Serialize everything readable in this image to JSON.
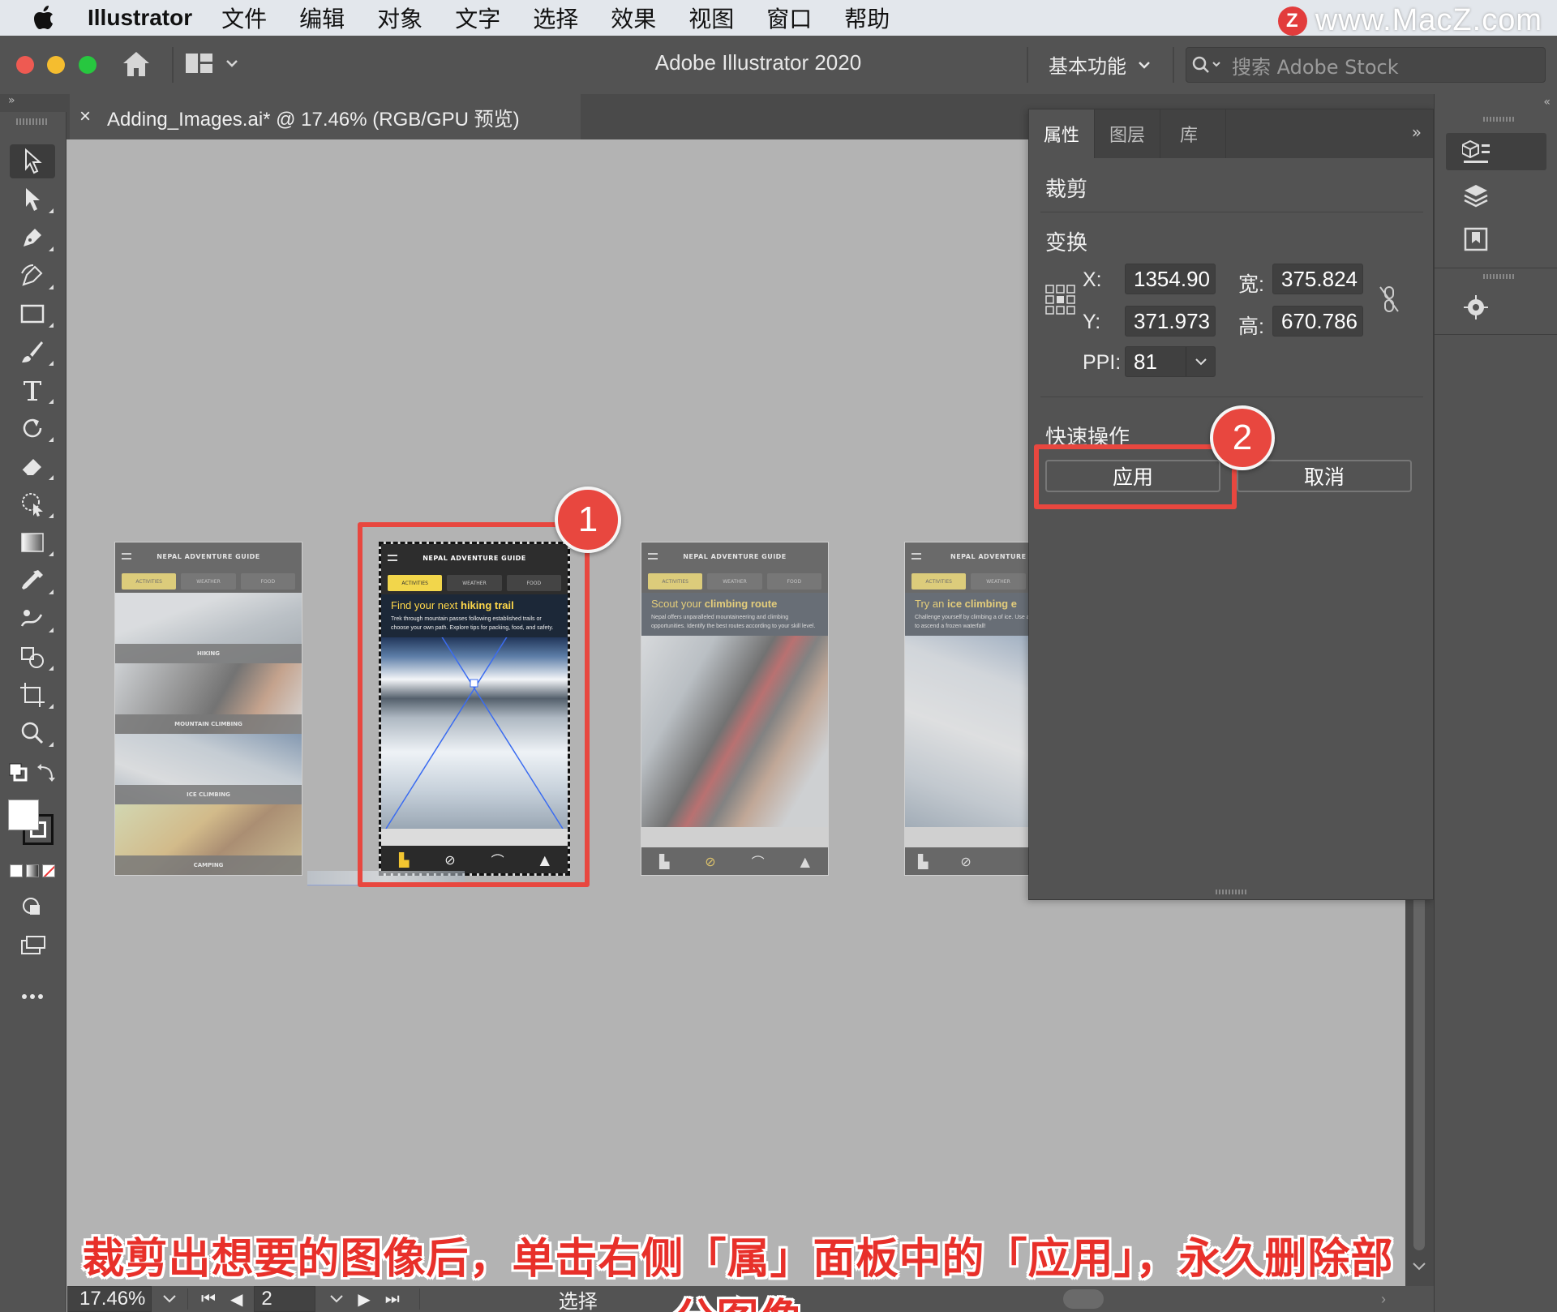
{
  "menubar": {
    "app_name": "Illustrator",
    "items": [
      "文件",
      "编辑",
      "对象",
      "文字",
      "选择",
      "效果",
      "视图",
      "窗口",
      "帮助"
    ],
    "watermark_logo": "Z",
    "watermark": "www.MacZ.com"
  },
  "titlebar": {
    "title": "Adobe Illustrator 2020",
    "workspace": "基本功能",
    "search_placeholder": "搜索 Adobe Stock"
  },
  "document": {
    "tab_close": "×",
    "tab_title": "Adding_Images.ai* @ 17.46% (RGB/GPU 预览)"
  },
  "artboards": [
    {
      "heading": "NEPAL ADVENTURE GUIDE",
      "tabs": [
        "ACTIVITIES",
        "WEATHER",
        "FOOD"
      ],
      "rows": [
        "HIKING",
        "MOUNTAIN CLIMBING",
        "ICE CLIMBING",
        "CAMPING"
      ]
    },
    {
      "heading": "NEPAL ADVENTURE GUIDE",
      "tabs": [
        "ACTIVITIES",
        "WEATHER",
        "FOOD"
      ],
      "title_pre": "Find your next ",
      "title_em": "hiking trail",
      "body": "Trek through mountain passes following established trails or choose your own path. Explore tips for packing, food, and safety."
    },
    {
      "heading": "NEPAL ADVENTURE GUIDE",
      "tabs": [
        "ACTIVITIES",
        "WEATHER",
        "FOOD"
      ],
      "title_pre": "Scout your ",
      "title_em": "climbing route",
      "body": "Nepal offers unparalleled mountaineering and climbing opportunities. Identify the best routes according to your skill level."
    },
    {
      "heading": "NEPAL ADVENTURE C",
      "tabs": [
        "ACTIVITIES",
        "WEATHER"
      ],
      "title_pre": "Try an ",
      "title_em": "ice climbing e",
      "body": "Challenge yourself by climbing a of ice. Use an ice axe, rope, and to ascend a frozen waterfall!"
    }
  ],
  "badges": {
    "one": "1",
    "two": "2"
  },
  "panel": {
    "tabs": [
      "属性",
      "图层",
      "库"
    ],
    "crop_title": "裁剪",
    "transform_title": "变换",
    "x_label": "X:",
    "x_value": "1354.90",
    "y_label": "Y:",
    "y_value": "371.973",
    "w_label": "宽:",
    "w_value": "375.824",
    "h_label": "高:",
    "h_value": "670.786",
    "ppi_label": "PPI:",
    "ppi_value": "81",
    "quick_title": "快速操作",
    "apply_label": "应用",
    "cancel_label": "取消"
  },
  "statusbar": {
    "zoom": "17.46%",
    "artboard_number": "2",
    "tool_name": "选择"
  },
  "caption": "裁剪出想要的图像后，单击右侧「属」面板中的「应用」，永久删除部分图像",
  "colors": {
    "accent_red": "#e8473f",
    "panel_bg": "#535353",
    "canvas_bg": "#b3b3b3",
    "ui_yellow": "#f2d64b"
  }
}
